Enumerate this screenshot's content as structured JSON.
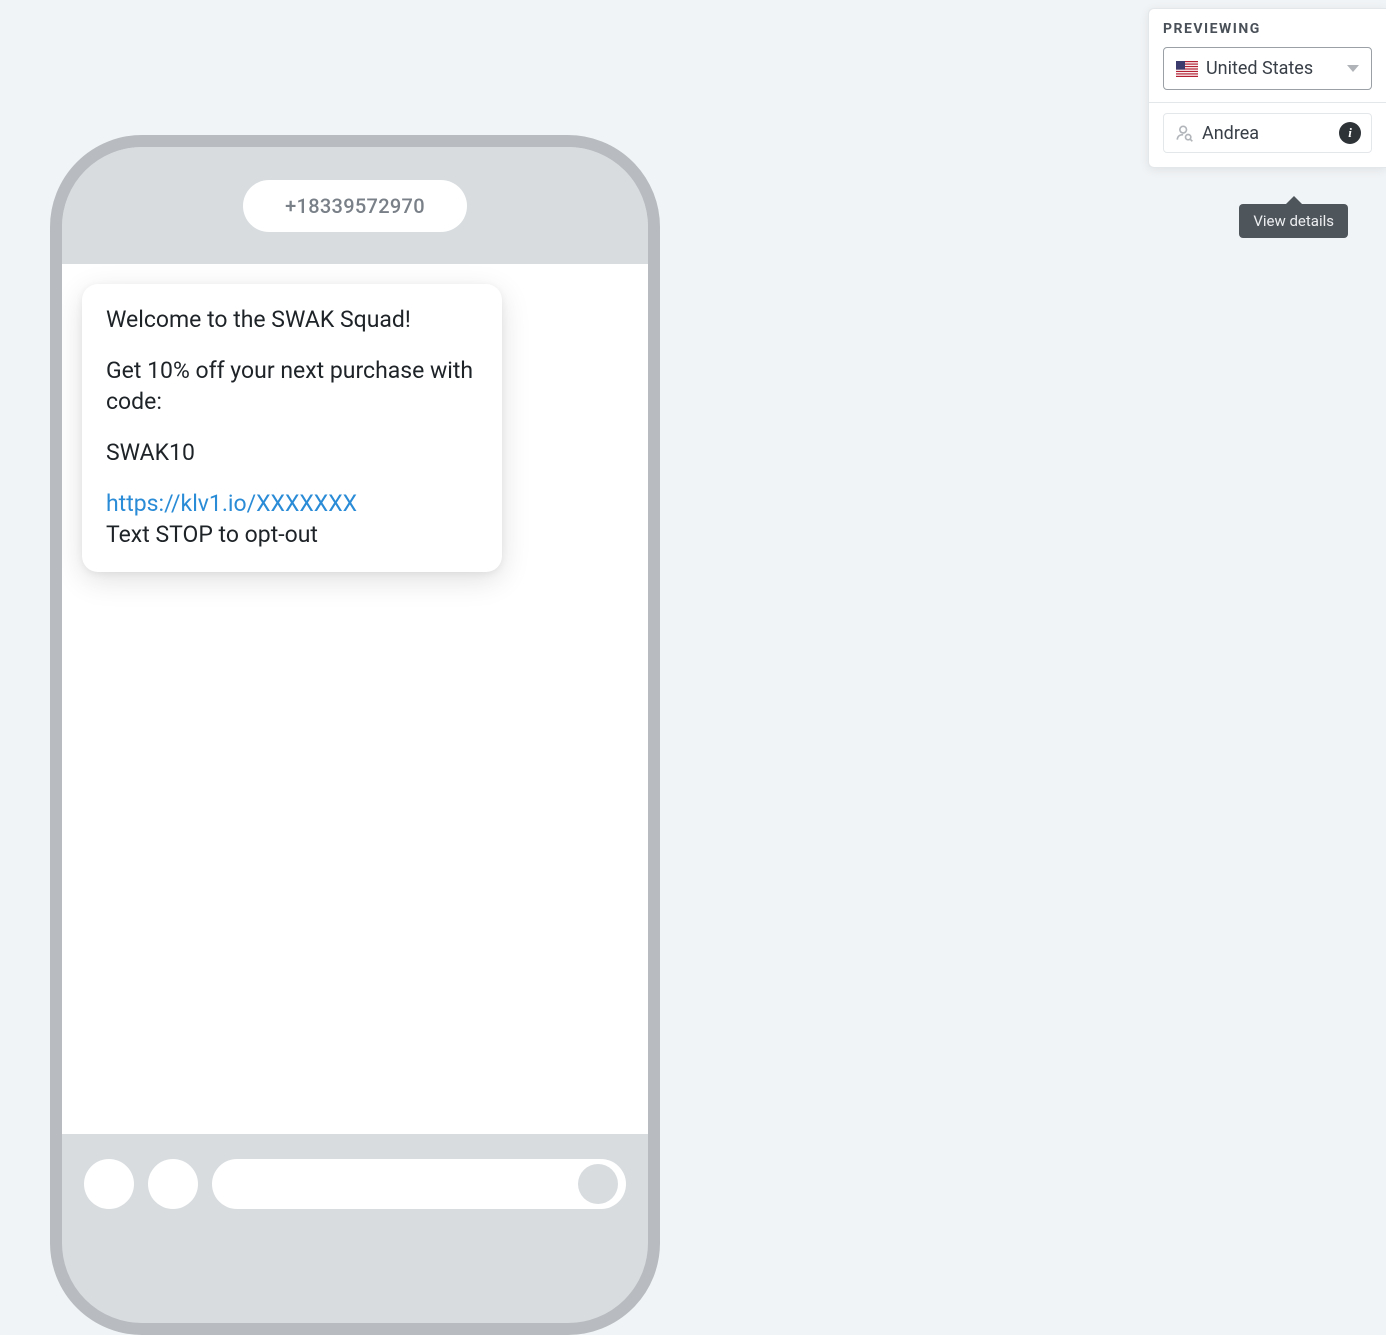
{
  "phone": {
    "sender": "+18339572970",
    "message": {
      "line1": "Welcome to the SWAK Squad!",
      "line2": "Get 10% off your next purchase with code:",
      "line3": "SWAK10",
      "link": "https://klv1.io/XXXXXXX",
      "line5": "Text STOP to opt-out"
    }
  },
  "preview_panel": {
    "title": "PREVIEWING",
    "country": "United States",
    "recipient": "Andrea",
    "tooltip": "View details"
  }
}
